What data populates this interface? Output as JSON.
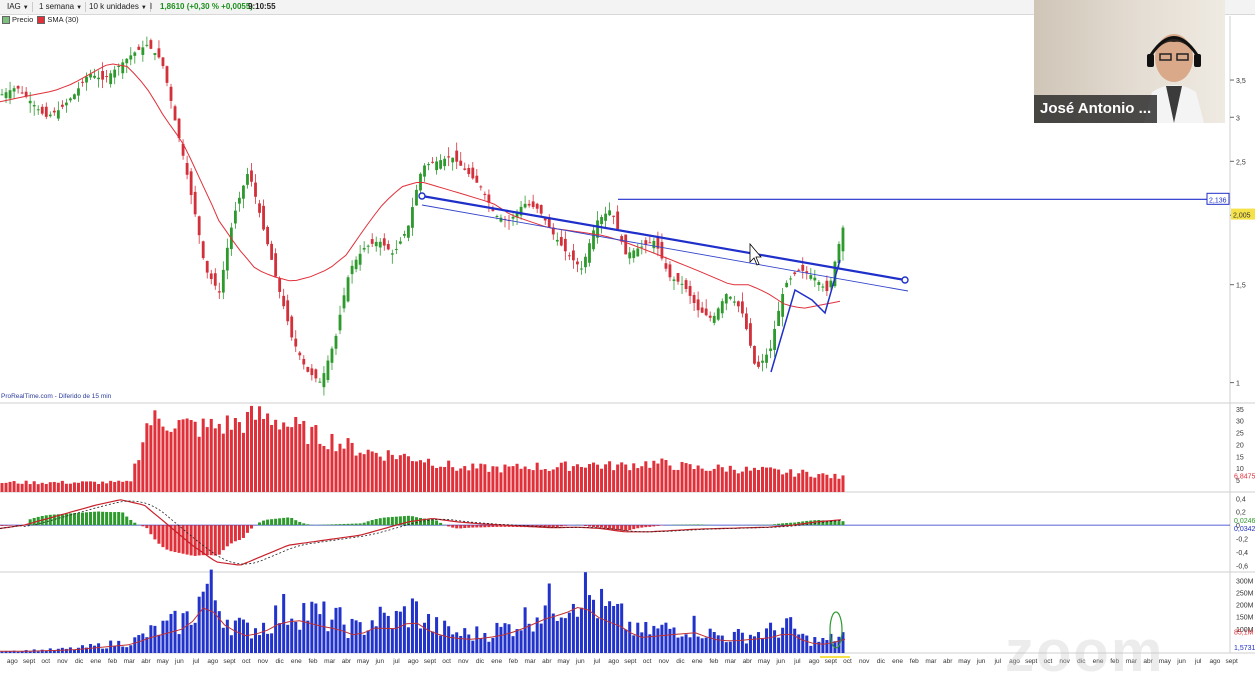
{
  "toolbar": {
    "ticker": "IAG",
    "period": "1 semana",
    "units": "10 k unidades",
    "price": "1,8610",
    "change": "(+0,30 % +0,0055)",
    "time": "9:10:55"
  },
  "legend": {
    "price_label": "Precio",
    "sma_label": "SMA (30)",
    "price_color": "#7fbf7f",
    "sma_color": "#e0303a"
  },
  "source_note": "ProRealTime.com - Diferido de 15 min",
  "webcam": {
    "name": "José Antonio ..."
  },
  "watermark": "zoom",
  "chart_data": [
    {
      "type": "candlestick",
      "scale": "log",
      "ylim": [
        0.95,
        4.2
      ],
      "y_ticks": [
        "3,5",
        "3",
        "2,5",
        "2",
        "1,5",
        "1"
      ],
      "y_tick_values": [
        3.5,
        3,
        2.5,
        2,
        1.5,
        1
      ],
      "horizontal_line": {
        "value": 2.136,
        "label": "2,136"
      },
      "last_price": {
        "value": 2.005,
        "label": "2,005"
      },
      "trendlines": [
        {
          "from": [
            "abr",
            2.55
          ],
          "to": [
            "may",
            1.68
          ],
          "color": "#1f2fc9"
        }
      ],
      "close_path": [
        3.3,
        3.4,
        3.2,
        3.0,
        3.1,
        3.3,
        3.6,
        3.5,
        3.7,
        3.9,
        4.05,
        3.8,
        2.9,
        2.2,
        1.6,
        1.45,
        2.0,
        2.4,
        1.9,
        1.5,
        1.2,
        1.05,
        1.0,
        1.2,
        1.6,
        1.75,
        1.8,
        1.7,
        1.9,
        2.45,
        2.5,
        2.55,
        2.4,
        2.25,
        2.0,
        1.95,
        2.1,
        2.05,
        1.85,
        1.7,
        1.6,
        1.95,
        2.05,
        1.7,
        1.75,
        1.8,
        1.55,
        1.5,
        1.35,
        1.3,
        1.45,
        1.35,
        1.05,
        1.15,
        1.5,
        1.6,
        1.55,
        1.45,
        1.9
      ],
      "sma30_path": [
        3.2,
        3.25,
        3.3,
        3.35,
        3.45,
        3.6,
        3.75,
        3.7,
        3.4,
        3.0,
        2.7,
        2.3,
        1.95,
        1.75,
        1.6,
        1.55,
        1.52,
        1.55,
        1.6,
        1.7,
        1.9,
        2.1,
        2.25,
        2.3,
        2.25,
        2.2,
        2.15,
        2.1,
        2.0,
        1.95,
        1.9,
        1.88,
        1.86,
        1.84,
        1.8,
        1.75,
        1.7,
        1.65,
        1.6,
        1.55,
        1.5,
        1.5,
        1.45,
        1.38,
        1.36,
        1.38,
        1.4
      ]
    },
    {
      "type": "bar",
      "title": "",
      "y_ticks": [
        "35",
        "30",
        "25",
        "20",
        "15",
        "10",
        "5"
      ],
      "y_tick_values": [
        35,
        30,
        25,
        20,
        15,
        10,
        5
      ],
      "last_value": {
        "value": 6.8475,
        "label": "6,8475"
      },
      "color": "#e0303a",
      "profile": [
        4,
        4,
        4,
        4,
        4,
        4,
        4,
        4,
        30,
        30,
        28,
        27,
        28,
        29,
        32,
        31,
        27,
        24,
        22,
        19,
        17,
        16,
        15,
        14,
        12,
        10,
        10,
        10,
        10,
        11,
        10,
        11,
        12,
        11,
        11,
        12,
        12,
        11,
        10,
        10,
        10,
        9,
        9,
        8,
        8,
        7,
        6
      ]
    },
    {
      "type": "macd",
      "y_ticks": [
        "0,4",
        "0,2",
        "0",
        "-0,2",
        "-0,4",
        "-0,6"
      ],
      "y_tick_values": [
        0.4,
        0.2,
        0,
        -0.2,
        -0.4,
        -0.6
      ],
      "labels": [
        "0,0246",
        "0,0342"
      ],
      "pos_color": "#2e9a2e",
      "neg_color": "#e0303a",
      "signal_color": "#222222",
      "line_path": [
        -0.05,
        0,
        0.1,
        0.2,
        0.3,
        0.38,
        0.3,
        0,
        -0.3,
        -0.55,
        -0.6,
        -0.45,
        -0.3,
        -0.25,
        -0.2,
        -0.15,
        -0.05,
        0.05,
        0.1,
        0.05,
        0.02,
        0,
        -0.02,
        -0.04,
        -0.03,
        -0.05,
        -0.1,
        -0.1,
        -0.08,
        -0.06,
        -0.05,
        -0.04,
        -0.03,
        0,
        0.05,
        0.08
      ]
    },
    {
      "type": "bar",
      "y_ticks": [
        "300M",
        "250M",
        "200M",
        "150M",
        "100M"
      ],
      "y_tick_values": [
        300,
        250,
        200,
        150,
        100
      ],
      "labels": [
        "85,1M",
        "1,5731"
      ],
      "color": "#2233cc",
      "ma_color": "#c03030",
      "profile": [
        10,
        10,
        12,
        15,
        20,
        30,
        40,
        50,
        90,
        120,
        150,
        290,
        160,
        100,
        120,
        180,
        190,
        160,
        140,
        100,
        150,
        140,
        190,
        120,
        90,
        80,
        90,
        110,
        150,
        200,
        230,
        280,
        200,
        160,
        90,
        100,
        110,
        120,
        80,
        70,
        80,
        90,
        120,
        60,
        50,
        80
      ]
    }
  ],
  "x_axis_labels": [
    "ago",
    "sept",
    "oct",
    "nov",
    "dic",
    "ene",
    "feb",
    "mar",
    "abr",
    "may",
    "jun",
    "jul",
    "ago",
    "sept",
    "oct",
    "nov",
    "dic",
    "ene",
    "feb",
    "mar",
    "abr",
    "may",
    "jun",
    "jul",
    "ago",
    "sept",
    "oct",
    "nov",
    "dic",
    "ene",
    "feb",
    "mar",
    "abr",
    "may",
    "jun",
    "jul",
    "ago",
    "sept",
    "oct",
    "nov",
    "dic",
    "ene",
    "feb",
    "mar",
    "abr",
    "may",
    "jun",
    "jul",
    "ago",
    "sept",
    "oct",
    "nov",
    "dic",
    "ene",
    "feb",
    "mar",
    "abr",
    "may",
    "jun",
    "jul",
    "ago",
    "sept",
    "oct",
    "nov",
    "dic",
    "ene",
    "feb",
    "mar",
    "abr",
    "may",
    "jun",
    "jul",
    "ago",
    "sept"
  ]
}
